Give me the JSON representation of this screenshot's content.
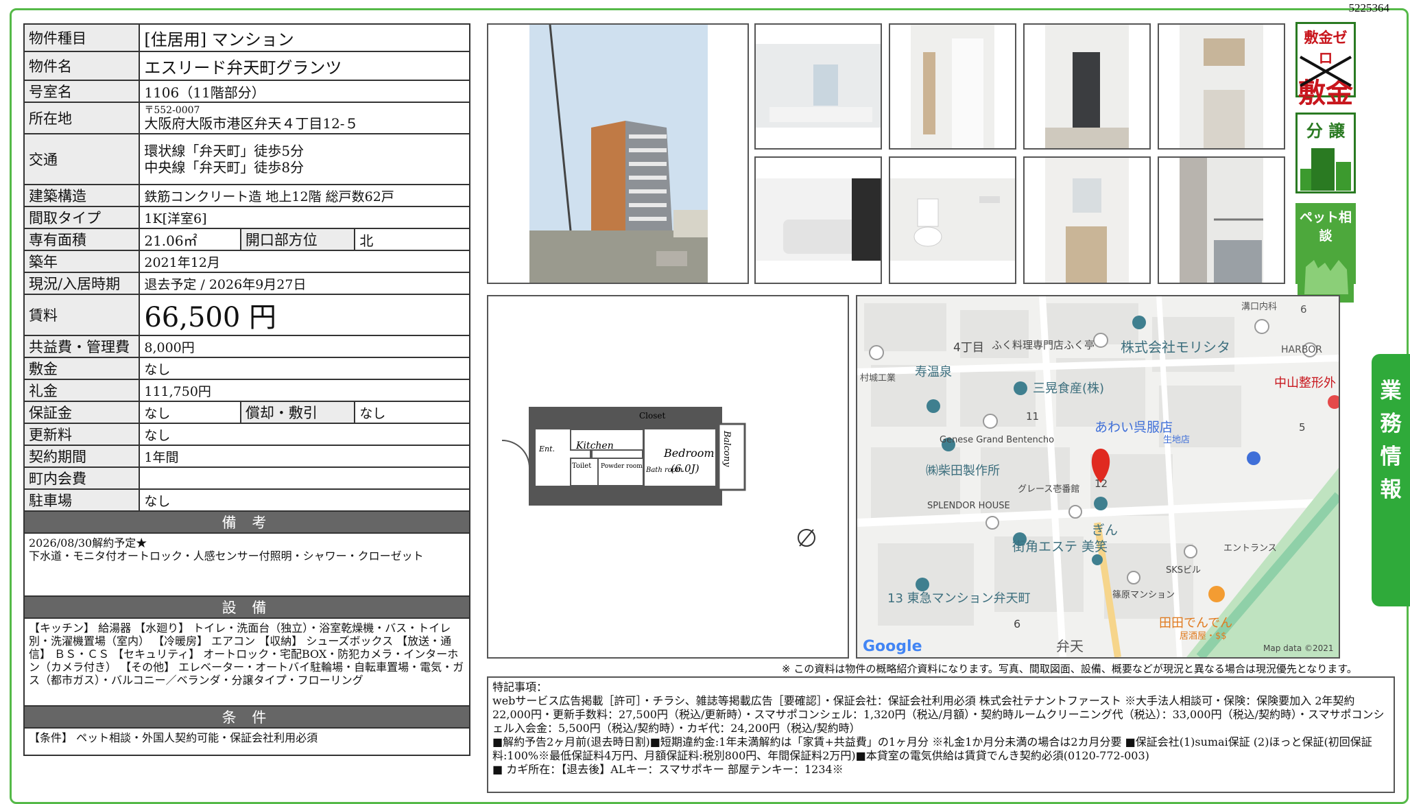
{
  "doc_id": "5225364",
  "spec": {
    "type_label": "物件種目",
    "type_value": "[住居用] マンション",
    "name_label": "物件名",
    "name_value": "エスリード弁天町グランツ",
    "room_label": "号室名",
    "room_value": "1106（11階部分）",
    "addr_label": "所在地",
    "addr_zip": "〒552-0007",
    "addr_value": "大阪府大阪市港区弁天４丁目12-５",
    "traffic_label": "交通",
    "traffic_1": "環状線「弁天町」徒歩5分",
    "traffic_2": "中央線「弁天町」徒歩8分",
    "structure_label": "建築構造",
    "structure_value": "鉄筋コンクリート造 地上12階 総戸数62戸",
    "layout_label": "間取タイプ",
    "layout_value": "1K[洋室6]",
    "area_label": "専有面積",
    "area_value": "21.06㎡",
    "dir_label": "開口部方位",
    "dir_value": "北",
    "built_label": "築年",
    "built_value": "2021年12月",
    "status_label": "現況/入居時期",
    "status_value": "退去予定 / 2026年9月27日",
    "rent_label": "賃料",
    "rent_value": "66,500 円",
    "fee_label": "共益費・管理費",
    "fee_value": "8,000円",
    "deposit_label": "敷金",
    "deposit_value": "なし",
    "key_label": "礼金",
    "key_value": "111,750円",
    "guar_label": "保証金",
    "guar_value": "なし",
    "amort_label": "償却・敷引",
    "amort_value": "なし",
    "renew_label": "更新料",
    "renew_value": "なし",
    "term_label": "契約期間",
    "term_value": "1年間",
    "town_label": "町内会費",
    "town_value": "",
    "parking_label": "駐車場",
    "parking_value": "なし",
    "remarks_title": "備 考",
    "remarks_1": "2026/08/30解約予定★",
    "remarks_2": "下水道・モニタ付オートロック・人感センサー付照明・シャワー・クローゼット",
    "equip_title": "設 備",
    "equip_text": "【キッチン】 給湯器 【水廻り】 トイレ・洗面台（独立）・浴室乾燥機・バス・トイレ別・洗濯機置場（室内） 【冷暖房】 エアコン 【収納】 シューズボックス 【放送・通信】 ＢＳ・ＣＳ 【セキュリティ】 オートロック・宅配BOX・防犯カメラ・インターホン（カメラ付き） 【その他】 エレベーター・オートバイ駐輪場・自転車置場・電気・ガス（都市ガス）・バルコニー／ベランダ・分譲タイプ・フローリング",
    "cond_title": "条 件",
    "cond_text": "【条件】 ペット相談・外国人契約可能・保証会社利用必須"
  },
  "badges": {
    "zero_title": "敷金ゼロ",
    "zero_word": "敷金",
    "bun_title": "分 譲",
    "pet_title": "ペット相談"
  },
  "floorplan": {
    "closet": "Closet",
    "kitchen": "Kitchen",
    "ent": "Ent.",
    "toilet": "Toilet",
    "powder": "Powder room",
    "bath": "Bath room",
    "bedroom": "Bedroom",
    "bedroom_size": "(6.0J)",
    "balcony": "Balcony"
  },
  "map": {
    "l_4chome": "4丁目",
    "l_fugu": "ふく料理専門店ふく亭",
    "l_morishita": "株式会社モリシタ",
    "l_mizoguchi": "溝口内科",
    "l_6a": "6",
    "l_harbor": "HARBOR",
    "l_muraki": "村城工業",
    "l_kotobuki": "寿温泉",
    "l_sanko": "三晃食産(株)",
    "l_nakayama": "中山整形外",
    "l_11": "11",
    "l_awai": "あわい呉服店",
    "l_awai_sub": "生地店",
    "l_5": "5",
    "l_genese": "Genese Grand Bentencho",
    "l_shibata": "㈱柴田製作所",
    "l_grace": "グレース壱番館",
    "l_12": "12",
    "l_splendor": "SPLENDOR HOUSE",
    "l_gin": "ぎん",
    "l_machikado": "街角エステ 美笑",
    "l_entrance": "エントランス",
    "l_sks": "SKSビル",
    "l_tokyu": "13 東急マンション弁天町",
    "l_shinohara": "篠原マンション",
    "l_tada": "田田でんでん",
    "l_tada_sub": "居酒屋・$$",
    "l_6b": "6",
    "l_benten": "弁天",
    "google": "Google",
    "mapdata": "Map data ©2021"
  },
  "side_tab": [
    "業",
    "務",
    "情",
    "報"
  ],
  "disclaimer": "※ この資料は物件の概略紹介資料になります。写真、間取図面、設備、概要などが現況と異なる場合は現況優先となります。",
  "special": {
    "title": "特記事項：",
    "line1": "webサービス広告掲載［許可］・チラシ、雑誌等掲載広告［要確認］・保証会社：保証会社利用必須 株式会社テナントファースト ※大手法人相談可・保険：保険要加入 2年契約 22,000円・更新手数料：27,500円（税込/更新時）・スマサポコンシェル：1,320円（税込/月額）・契約時ルームクリーニング代（税込）：33,000円（税込/契約時）・スマサポコンシェル入会金：5,500円（税込/契約時）・カギ代：24,200円（税込/契約時）",
    "line2": "■解約予告2ヶ月前(退去時日割)■短期違約金:1年未満解約は「家賃+共益費」の1ヶ月分 ※礼金1か月分未満の場合は2カ月分要 ■保証会社(1)sumai保証 (2)ほっと保証(初回保証料:100%※最低保証料4万円、月額保証料:税別800円、年間保証料2万円)■本貸室の電気供給は賃貸でんき契約必須(0120-772-003)",
    "line3": "■ カギ所在：【退去後】ALキー：スマサポキー 部屋テンキー：1234※"
  }
}
